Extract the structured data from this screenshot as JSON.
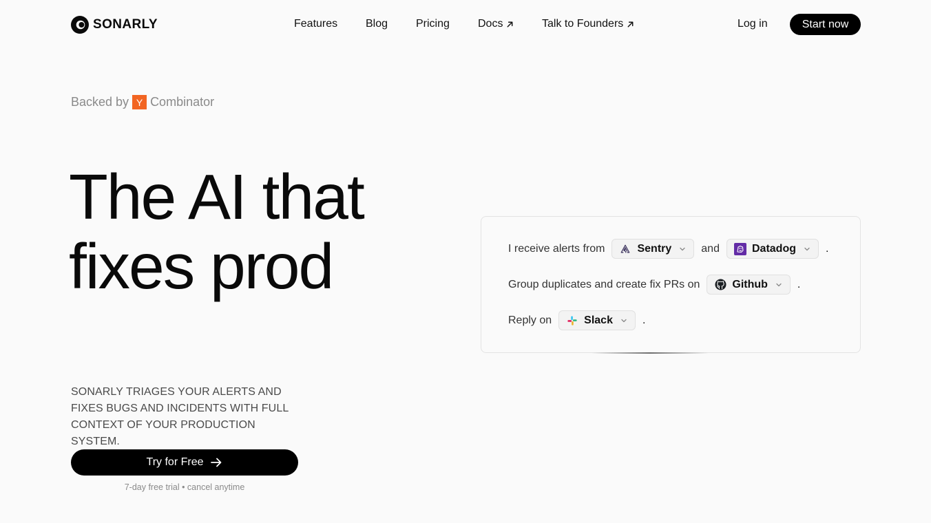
{
  "header": {
    "logo_text": "SONARLY",
    "nav": [
      {
        "label": "Features",
        "external": false
      },
      {
        "label": "Blog",
        "external": false
      },
      {
        "label": "Pricing",
        "external": false
      },
      {
        "label": "Docs",
        "external": true
      },
      {
        "label": "Talk to Founders",
        "external": true
      }
    ],
    "login_label": "Log in",
    "start_label": "Start now"
  },
  "hero": {
    "backed_prefix": "Backed by",
    "yc_letter": "Y",
    "backed_suffix": "Combinator",
    "headline_line1": "The AI that",
    "headline_line2": "fixes prod",
    "subtext_lines": [
      "SONARLY TRIAGES YOUR ALERTS AND",
      "FIXES BUGS AND INCIDENTS WITH FULL",
      "CONTEXT OF YOUR PRODUCTION SYSTEM."
    ],
    "cta_label": "Try for Free",
    "trial_note": "7-day free trial • cancel anytime"
  },
  "config": {
    "row1": {
      "text": "I receive alerts from",
      "source1": "Sentry",
      "joiner": "and",
      "source2": "Datadog",
      "end": "."
    },
    "row2": {
      "text": "Group duplicates and create fix PRs on",
      "target": "Github",
      "end": "."
    },
    "row3": {
      "text": "Reply on",
      "channel": "Slack",
      "end": "."
    }
  },
  "colors": {
    "yc_orange": "#f26522",
    "datadog_purple": "#632ca6",
    "primary_button": "#000000"
  }
}
